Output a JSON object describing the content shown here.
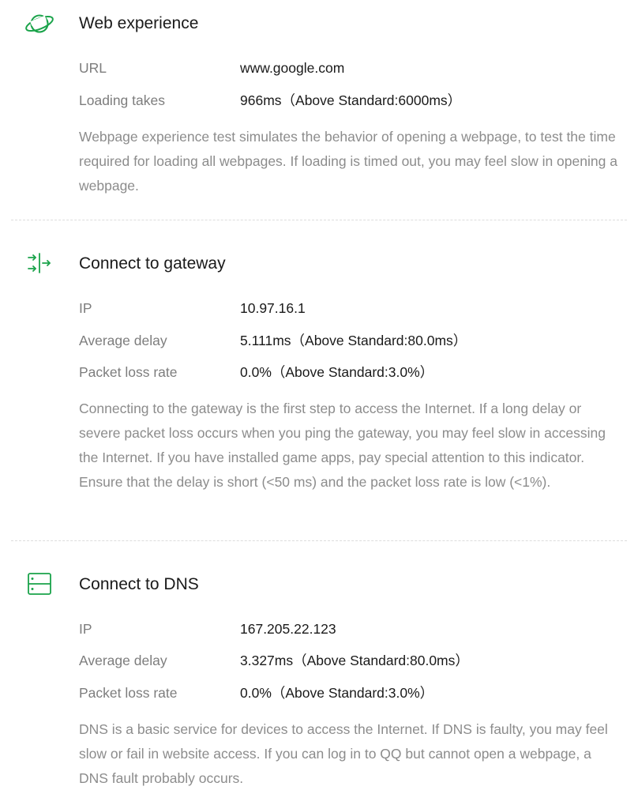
{
  "accent_color": "#1aa34a",
  "sections": [
    {
      "icon": "planet-icon",
      "title": "Web experience",
      "rows": [
        {
          "label": "URL",
          "value": "www.google.com"
        },
        {
          "label": "Loading takes",
          "value": "966ms（Above Standard:6000ms）"
        }
      ],
      "description": "Webpage experience test simulates the behavior of opening a webpage, to test the time required for loading all webpages. If loading is timed out, you may feel slow in opening a webpage."
    },
    {
      "icon": "gateway-arrows-icon",
      "title": "Connect to gateway",
      "rows": [
        {
          "label": "IP",
          "value": "10.97.16.1"
        },
        {
          "label": "Average delay",
          "value": "5.111ms（Above Standard:80.0ms）"
        },
        {
          "label": "Packet loss rate",
          "value": "0.0%（Above Standard:3.0%）"
        }
      ],
      "description": "Connecting to the gateway is the first step to access the Internet. If a long delay or severe packet loss occurs when you ping the gateway, you may feel slow in accessing the Internet. If you have installed game apps, pay special attention to this indicator. Ensure that the delay is short (<50 ms) and the packet loss rate is low (<1%)."
    },
    {
      "icon": "dns-server-icon",
      "title": "Connect to DNS",
      "rows": [
        {
          "label": "IP",
          "value": "167.205.22.123"
        },
        {
          "label": "Average delay",
          "value": "3.327ms（Above Standard:80.0ms）"
        },
        {
          "label": "Packet loss rate",
          "value": "0.0%（Above Standard:3.0%）"
        }
      ],
      "description": "DNS is a basic service for devices to access the Internet. If DNS is faulty, you may feel slow or fail in website access. If you can log in to QQ but cannot open a webpage, a DNS fault probably occurs."
    }
  ]
}
